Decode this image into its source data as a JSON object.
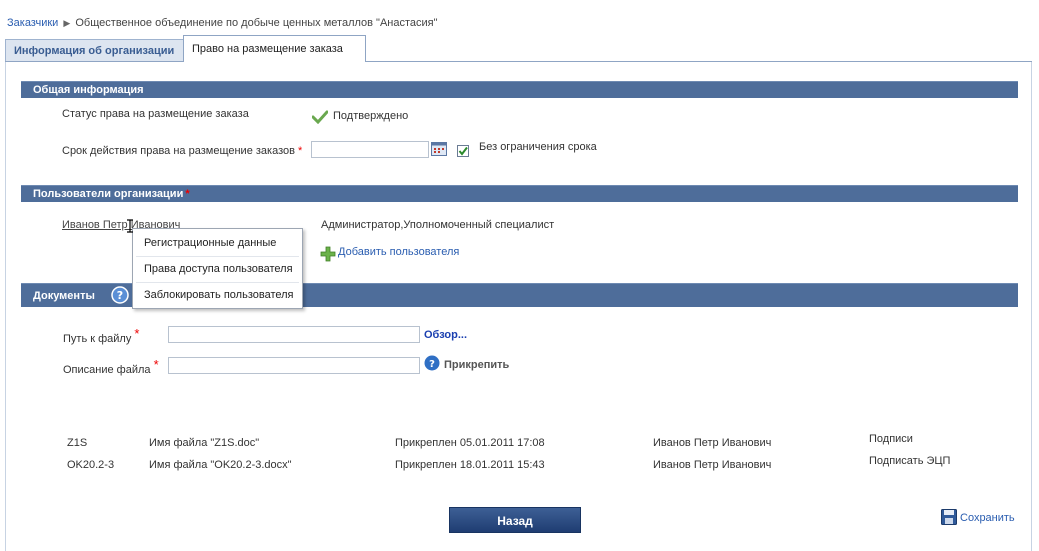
{
  "breadcrumb": {
    "root": "Заказчики",
    "current": "Общественное объединение по добыче ценных металлов \"Анастасия\""
  },
  "tabs": [
    {
      "label": "Информация об организации"
    },
    {
      "label": "Право на размещение заказа"
    }
  ],
  "general": {
    "header": "Общая информация",
    "status_label": "Статус права на размещение заказа",
    "status_value": "Подтверждено",
    "term_label": "Срок действия права на размещение заказов",
    "term_required": "*",
    "term_value": "",
    "unlimited_label": "Без ограничения срока",
    "unlimited_checked": true
  },
  "users": {
    "header": "Пользователи организации",
    "user_name": "Иванов Петр Иванович",
    "user_roles": "Администратор,Уполномоченный специалист",
    "add_user": "Добавить пользователя",
    "context_menu": [
      "Регистрационные данные",
      "Права доступа пользователя",
      "Заблокировать пользователя"
    ]
  },
  "documents": {
    "header": "Документы",
    "path_label": "Путь к файлу",
    "path_required": "*",
    "browse": "Обзор...",
    "desc_label": "Описание файла",
    "desc_required": "*",
    "attach": "Прикрепить",
    "rows": [
      {
        "code": "Z1S",
        "file": "Имя файла \"Z1S.doc\"",
        "attached": "Прикреплен 05.01.2011 17:08",
        "author": "Иванов Петр Иванович",
        "action": "Подписи"
      },
      {
        "code": "OK20.2-3",
        "file": "Имя файла \"OK20.2-3.docx\"",
        "attached": "Прикреплен 18.01.2011 15:43",
        "author": "Иванов Петр Иванович",
        "action": "Подписать ЭЦП"
      }
    ]
  },
  "footer": {
    "back": "Назад",
    "save": "Сохранить"
  },
  "colors": {
    "section_header": "#4e6d9a",
    "link": "#2a5db0",
    "button": "#2b4a80",
    "required": "#ee0000"
  }
}
